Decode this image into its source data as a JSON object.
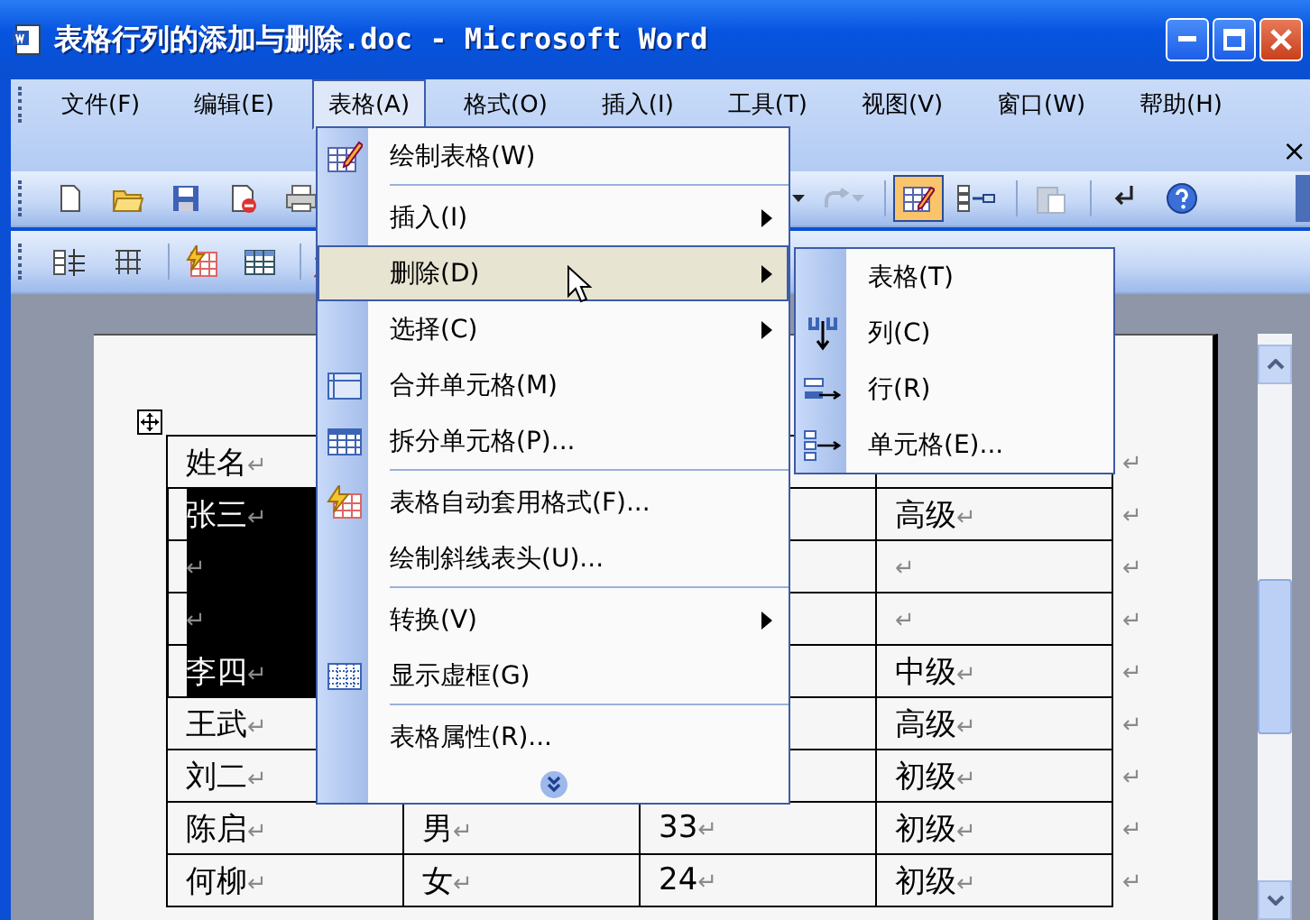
{
  "window": {
    "title": "表格行列的添加与删除.doc - Microsoft Word"
  },
  "menu_bar": [
    {
      "label": "文件(F)",
      "selected": false
    },
    {
      "label": "编辑(E)",
      "selected": false
    },
    {
      "label": "表格(A)",
      "selected": true
    },
    {
      "label": "格式(O)",
      "selected": false
    },
    {
      "label": "插入(I)",
      "selected": false
    },
    {
      "label": "工具(T)",
      "selected": false
    },
    {
      "label": "视图(V)",
      "selected": false
    },
    {
      "label": "窗口(W)",
      "selected": false
    },
    {
      "label": "帮助(H)",
      "selected": false
    }
  ],
  "document_close": "×",
  "standard_toolbar": {
    "redo": {
      "disabled": true
    },
    "tables_and_borders": {
      "on": true
    },
    "paste": {
      "disabled": true
    }
  },
  "table_menu": [
    {
      "kind": "icon",
      "label": "绘制表格(W)",
      "selected": false
    },
    {
      "kind": "separator"
    },
    {
      "kind": "submenu",
      "label": "插入(I)",
      "selected": false
    },
    {
      "kind": "submenu",
      "label": "删除(D)",
      "selected": true
    },
    {
      "kind": "submenu",
      "label": "选择(C)",
      "selected": false
    },
    {
      "kind": "icon",
      "label": "合并单元格(M)",
      "selected": false
    },
    {
      "kind": "icon",
      "label": "拆分单元格(P)...",
      "selected": false
    },
    {
      "kind": "separator"
    },
    {
      "kind": "icon",
      "label": "表格自动套用格式(F)...",
      "selected": false
    },
    {
      "kind": "plain",
      "label": "绘制斜线表头(U)...",
      "selected": false
    },
    {
      "kind": "separator"
    },
    {
      "kind": "submenu",
      "label": "转换(V)",
      "selected": false
    },
    {
      "kind": "icon",
      "label": "显示虚框(G)",
      "selected": false
    },
    {
      "kind": "separator"
    },
    {
      "kind": "plain",
      "label": "表格属性(R)...",
      "selected": false
    },
    {
      "kind": "more"
    }
  ],
  "delete_submenu": [
    {
      "kind": "plain",
      "label": "表格(T)",
      "selected": false
    },
    {
      "kind": "icon",
      "label": "列(C)",
      "selected": false
    },
    {
      "kind": "icon",
      "label": "行(R)",
      "selected": false
    },
    {
      "kind": "icon",
      "label": "单元格(E)...",
      "selected": false
    }
  ],
  "table": {
    "rows": [
      {
        "name": {
          "text": "姓名",
          "mark": "↵",
          "selected": false
        },
        "end_mark": "↵"
      },
      {
        "name": {
          "text": "张三",
          "mark": "↵",
          "selected": true
        },
        "level": {
          "text": "高级",
          "mark": "↵",
          "selected": false
        },
        "end_mark": "↵"
      },
      {
        "name": {
          "mark": "↵",
          "selected": true
        },
        "level": {
          "mark": "↵",
          "selected": false
        },
        "end_mark": "↵"
      },
      {
        "name": {
          "mark": "↵",
          "selected": true
        },
        "level": {
          "mark": "↵",
          "selected": false
        },
        "end_mark": "↵"
      },
      {
        "name": {
          "text": "李四",
          "mark": "↵",
          "selected": true
        },
        "level": {
          "text": "中级",
          "mark": "↵",
          "selected": false
        },
        "end_mark": "↵"
      },
      {
        "name": {
          "text": "王武",
          "mark": "↵",
          "selected": false
        },
        "level": {
          "text": "高级",
          "mark": "↵",
          "selected": false
        },
        "end_mark": "↵"
      },
      {
        "name": {
          "text": "刘二",
          "mark": "↵",
          "selected": false
        },
        "level": {
          "text": "初级",
          "mark": "↵",
          "selected": false
        },
        "end_mark": "↵"
      },
      {
        "name": {
          "text": "陈启",
          "mark": "↵",
          "selected": false
        },
        "gender": {
          "text": "男",
          "mark": "↵",
          "selected": false
        },
        "age": {
          "text": "33",
          "mark": "↵",
          "selected": false
        },
        "level": {
          "text": "初级",
          "mark": "↵",
          "selected": false
        },
        "end_mark": "↵"
      },
      {
        "name": {
          "text": "何柳",
          "mark": "↵",
          "selected": false
        },
        "gender": {
          "text": "女",
          "mark": "↵",
          "selected": false
        },
        "age": {
          "text": "24",
          "mark": "↵",
          "selected": false
        },
        "level": {
          "text": "初级",
          "mark": "↵",
          "selected": false
        },
        "end_mark": "↵"
      }
    ]
  }
}
